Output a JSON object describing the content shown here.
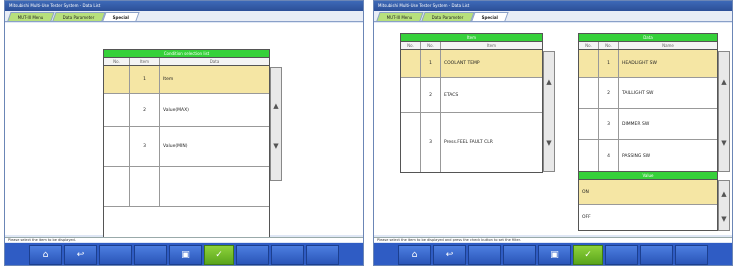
{
  "left": {
    "title": "Mitsubishi Multi-Use Tester System - Data List",
    "tabs": [
      "MUT-III Menu",
      "Data Parameter",
      "Special"
    ],
    "table": {
      "title": "Condition selection list",
      "columns": [
        "No.",
        "Item",
        "Data"
      ],
      "rows": [
        {
          "no": "1",
          "item": "Item"
        },
        {
          "no": "2",
          "item": "Value(MAX)"
        },
        {
          "no": "3",
          "item": "Value(MIN)"
        }
      ]
    },
    "status": "Please select the item to be displayed.",
    "toolbar": [
      "home-icon",
      "back-icon",
      "print-icon",
      "check-icon"
    ]
  },
  "right": {
    "title": "Mitsubishi Multi-Use Tester System - Data List",
    "tabs": [
      "MUT-III Menu",
      "Data Parameter",
      "Special"
    ],
    "table_a": {
      "title": "Item",
      "columns": [
        "No.",
        "No.",
        "Item"
      ],
      "rows": [
        {
          "no": "1",
          "item": "COOLANT TEMP"
        },
        {
          "no": "2",
          "item": "ETACS"
        },
        {
          "no": "3",
          "item": "Press.FEEL FAULT CLR"
        }
      ]
    },
    "table_b": {
      "title": "Data",
      "columns": [
        "No.",
        "No.",
        "Name"
      ],
      "rows": [
        {
          "no": "1",
          "item": "HEADLIGHT SW"
        },
        {
          "no": "2",
          "item": "TAILLIGHT SW"
        },
        {
          "no": "3",
          "item": "DIMMER SW"
        },
        {
          "no": "4",
          "item": "PASSING SW"
        }
      ]
    },
    "table_c": {
      "title": "Value",
      "rows": [
        {
          "value": "ON"
        },
        {
          "value": "OFF"
        }
      ]
    },
    "status": "Please select the item to be displayed and press the check button to set the filter.",
    "toolbar": [
      "home-icon",
      "back-icon",
      "print-icon",
      "check-icon"
    ]
  },
  "colors": {
    "header_green": "#36d13a",
    "selection": "#f5e6a4",
    "toolbar_blue": "#2f5cc4"
  }
}
